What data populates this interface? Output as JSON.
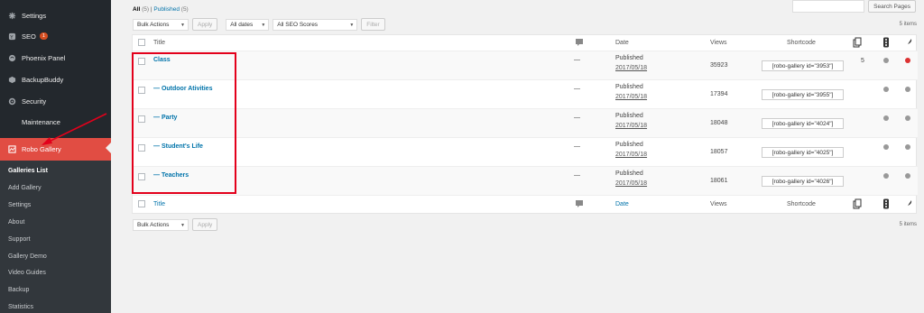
{
  "sidebar": {
    "items": [
      {
        "label": "Settings",
        "icon": "settings-icon"
      },
      {
        "label": "SEO",
        "icon": "seo-icon",
        "badge": "1"
      },
      {
        "label": "Phoenix Panel",
        "icon": "phoenix-icon"
      },
      {
        "label": "BackupBuddy",
        "icon": "backupbuddy-icon"
      },
      {
        "label": "Security",
        "icon": "security-icon"
      },
      {
        "label": "Maintenance",
        "icon": ""
      },
      {
        "label": "Robo Gallery",
        "icon": "gallery-icon"
      }
    ],
    "submenu": [
      "Galleries List",
      "Add Gallery",
      "Settings",
      "About",
      "Support",
      "Gallery Demo",
      "Video Guides",
      "Backup",
      "Statistics"
    ]
  },
  "filters": {
    "all_label": "All",
    "all_count": "(5)",
    "separator": "|",
    "published_label": "Published",
    "published_count": "(5)"
  },
  "search": {
    "button": "Search Pages"
  },
  "tablenav_top": {
    "bulk_actions": "Bulk Actions",
    "apply": "Apply",
    "dates": "All dates",
    "seo_scores": "All SEO Scores",
    "filter": "Filter",
    "items_count": "5 items"
  },
  "table": {
    "headers": {
      "title": "Title",
      "date": "Date",
      "views": "Views",
      "shortcode": "Shortcode"
    },
    "rows": [
      {
        "title": "Class",
        "comments": "—",
        "status": "Published",
        "date": "2017/05/18",
        "views": "35923",
        "shortcode": "[robo-gallery id=\"3953\"]",
        "count": "5",
        "status_color": "#dc3232"
      },
      {
        "title": "— Outdoor Ativities",
        "comments": "—",
        "status": "Published",
        "date": "2017/05/18",
        "views": "17394",
        "shortcode": "[robo-gallery id=\"3955\"]",
        "count": "",
        "status_color": "#999999"
      },
      {
        "title": "— Party",
        "comments": "—",
        "status": "Published",
        "date": "2017/05/18",
        "views": "18048",
        "shortcode": "[robo-gallery id=\"4024\"]",
        "count": "",
        "status_color": "#999999"
      },
      {
        "title": "— Student's Life",
        "comments": "—",
        "status": "Published",
        "date": "2017/05/18",
        "views": "18057",
        "shortcode": "[robo-gallery id=\"4025\"]",
        "count": "",
        "status_color": "#999999"
      },
      {
        "title": "— Teachers",
        "comments": "—",
        "status": "Published",
        "date": "2017/05/18",
        "views": "18061",
        "shortcode": "[robo-gallery id=\"4026\"]",
        "count": "",
        "status_color": "#999999"
      }
    ]
  },
  "tablenav_bottom": {
    "bulk_actions": "Bulk Actions",
    "apply": "Apply",
    "items_count": "5 items"
  },
  "colors": {
    "accent": "#e14d43",
    "link": "#0073aa",
    "sidebar": "#23282d",
    "highlight": "#e3001b"
  }
}
